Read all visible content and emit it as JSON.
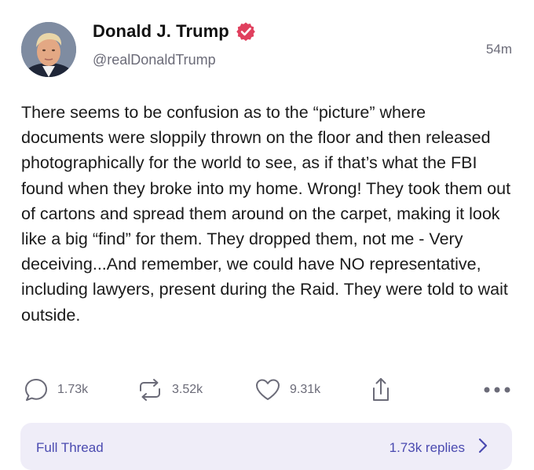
{
  "post": {
    "author": {
      "display_name": "Donald J. Trump",
      "handle": "@realDonaldTrump",
      "verified": true
    },
    "time_ago": "54m",
    "text": "There seems to be confusion as to the “picture” where documents were sloppily thrown on the floor and then released photographically for the world to see, as if that’s what the FBI found when they broke into my home. Wrong! They took them out of cartons and spread them around on the carpet, making it look like a big “find” for them. They dropped them, not me - Very deceiving...And remember, we could have NO representative, including lawyers, present during the Raid. They were told to wait outside.",
    "actions": {
      "replies": "1.73k",
      "retruths": "3.52k",
      "likes": "9.31k"
    }
  },
  "thread_card": {
    "label": "Full Thread",
    "replies": "1.73k replies"
  },
  "colors": {
    "verified_badge": "#e0405e",
    "icon_gray": "#6b6b78",
    "thread_card_bg": "#efedf8",
    "thread_link": "#4a4ab0"
  }
}
